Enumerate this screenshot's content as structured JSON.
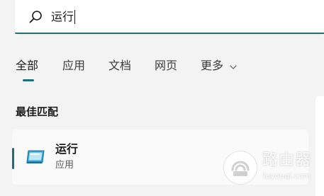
{
  "search": {
    "value": "运行",
    "icon": "search-icon",
    "accent": "#1f6f78"
  },
  "tabs": [
    {
      "label": "全部",
      "active": true
    },
    {
      "label": "应用",
      "active": false
    },
    {
      "label": "文档",
      "active": false
    },
    {
      "label": "网页",
      "active": false
    },
    {
      "label": "更多",
      "active": false,
      "icon": "chevron-down-icon"
    }
  ],
  "best_match": {
    "heading": "最佳匹配",
    "item": {
      "title": "运行",
      "subtitle": "应用",
      "icon": "run-app-icon"
    }
  },
  "watermark": {
    "title": "路由器",
    "domain": "luyouqi.com"
  }
}
